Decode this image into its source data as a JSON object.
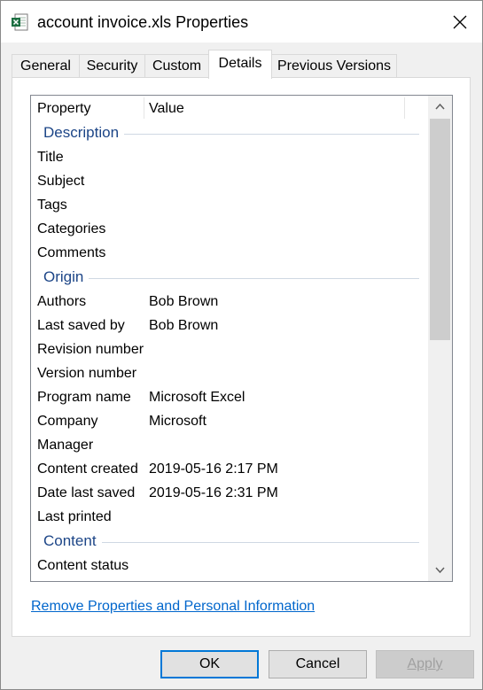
{
  "window": {
    "title": "account invoice.xls Properties"
  },
  "tabs": [
    {
      "label": "General"
    },
    {
      "label": "Security"
    },
    {
      "label": "Custom"
    },
    {
      "label": "Details"
    },
    {
      "label": "Previous Versions"
    }
  ],
  "active_tab": "Details",
  "list": {
    "col_property": "Property",
    "col_value": "Value",
    "groups": [
      {
        "label": "Description",
        "rows": [
          {
            "prop": "Title",
            "val": ""
          },
          {
            "prop": "Subject",
            "val": ""
          },
          {
            "prop": "Tags",
            "val": ""
          },
          {
            "prop": "Categories",
            "val": ""
          },
          {
            "prop": "Comments",
            "val": ""
          }
        ]
      },
      {
        "label": "Origin",
        "rows": [
          {
            "prop": "Authors",
            "val": "Bob Brown"
          },
          {
            "prop": "Last saved by",
            "val": "Bob Brown"
          },
          {
            "prop": "Revision number",
            "val": ""
          },
          {
            "prop": "Version number",
            "val": ""
          },
          {
            "prop": "Program name",
            "val": "Microsoft Excel"
          },
          {
            "prop": "Company",
            "val": "Microsoft"
          },
          {
            "prop": "Manager",
            "val": ""
          },
          {
            "prop": "Content created",
            "val": "2019-05-16 2:17 PM"
          },
          {
            "prop": "Date last saved",
            "val": "2019-05-16 2:31 PM"
          },
          {
            "prop": "Last printed",
            "val": ""
          }
        ]
      },
      {
        "label": "Content",
        "rows": [
          {
            "prop": "Content status",
            "val": ""
          }
        ]
      }
    ]
  },
  "link": {
    "remove_label": "Remove Properties and Personal Information"
  },
  "buttons": {
    "ok": "OK",
    "cancel": "Cancel",
    "apply": "Apply"
  },
  "colors": {
    "accent": "#0078d7",
    "link": "#0066cc",
    "group_label": "#1c4587",
    "excel_green": "#1d6f42"
  },
  "icons": {
    "title": "excel-file-icon",
    "close": "close-icon",
    "scroll_up": "chevron-up-icon",
    "scroll_down": "chevron-down-icon"
  }
}
